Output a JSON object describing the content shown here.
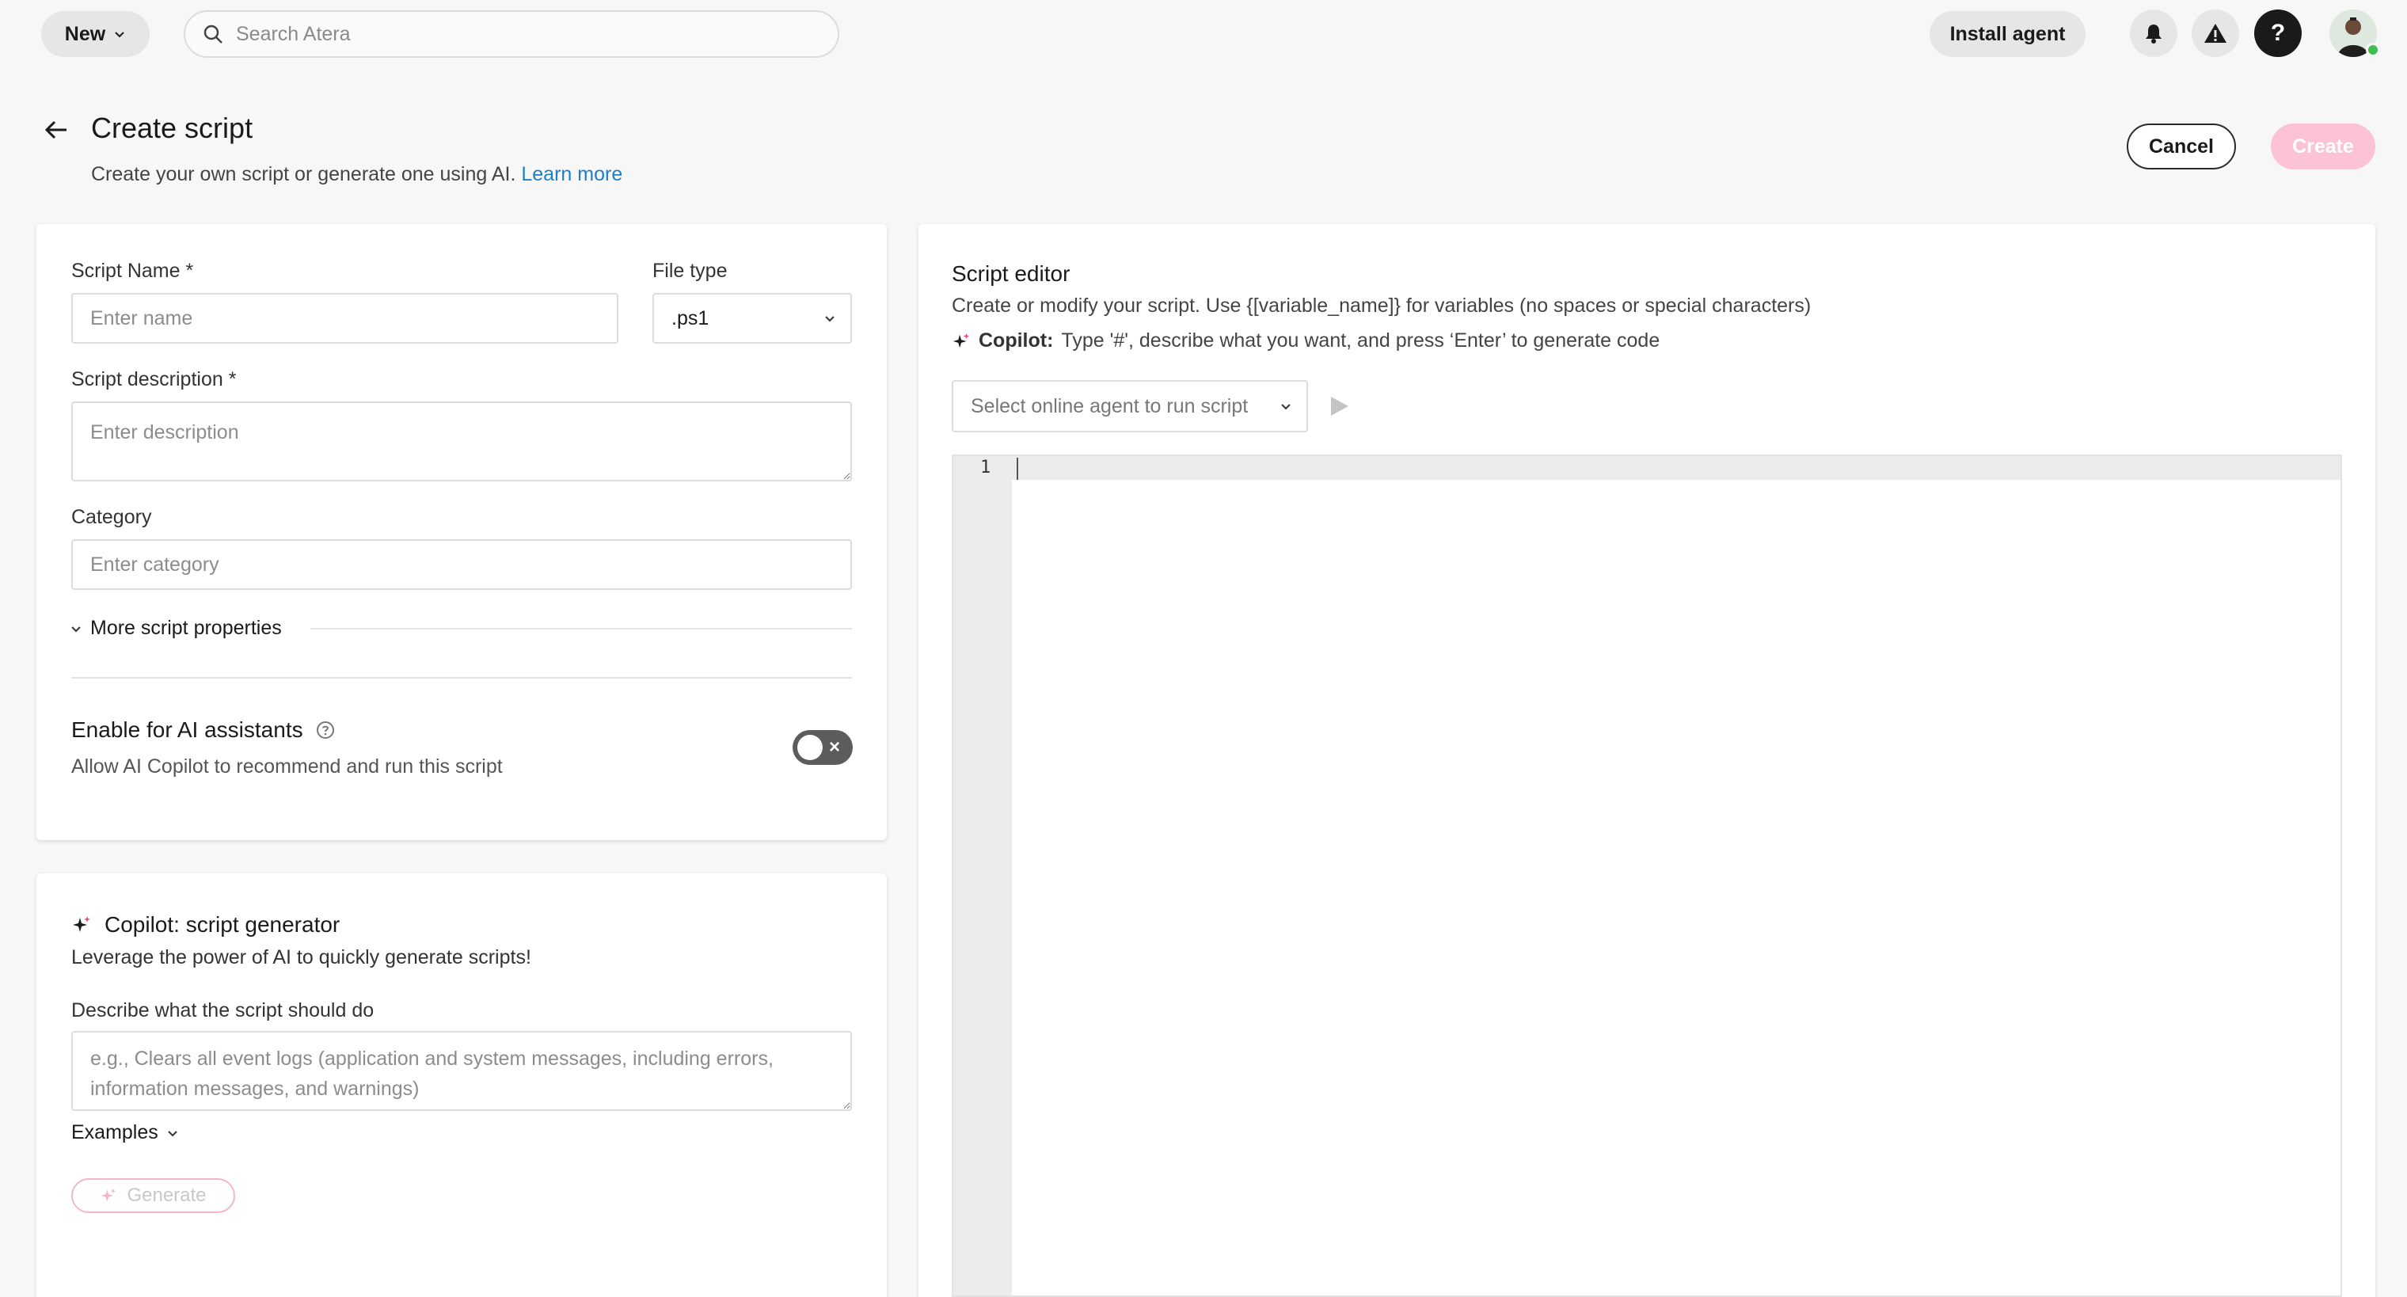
{
  "topbar": {
    "new_label": "New",
    "search_placeholder": "Search Atera",
    "install_label": "Install agent",
    "help_glyph": "?"
  },
  "header": {
    "title": "Create script",
    "subtitle": "Create your own script or generate one using AI.",
    "learn_more": "Learn more",
    "cancel_label": "Cancel",
    "create_label": "Create"
  },
  "form": {
    "script_name_label": "Script Name *",
    "script_name_placeholder": "Enter name",
    "file_type_label": "File type",
    "file_type_value": ".ps1",
    "description_label": "Script description *",
    "description_placeholder": "Enter description",
    "category_label": "Category",
    "category_placeholder": "Enter category",
    "more_properties": "More script properties",
    "ai_title": "Enable for AI assistants",
    "ai_subtitle": "Allow AI Copilot to recommend and run this script",
    "ai_enabled": false
  },
  "copilot": {
    "title": "Copilot: script generator",
    "subtitle": "Leverage the power of AI to quickly generate scripts!",
    "describe_label": "Describe what the script should do",
    "describe_placeholder": "e.g., Clears all event logs (application and system messages, including errors, information messages, and warnings)",
    "examples_label": "Examples",
    "generate_label": "Generate"
  },
  "editor": {
    "title": "Script editor",
    "description": "Create or modify your script. Use {[variable_name]} for variables (no spaces or special characters)",
    "copilot_prefix": "Copilot:",
    "copilot_hint": "Type '#', describe what you want, and press ‘Enter’ to generate code",
    "agent_placeholder": "Select online agent to run script",
    "line_number": "1"
  },
  "colors": {
    "accent_pink": "#fcc3d6",
    "link_blue": "#1e7fc7",
    "toggle_off": "#5c5c5c"
  }
}
